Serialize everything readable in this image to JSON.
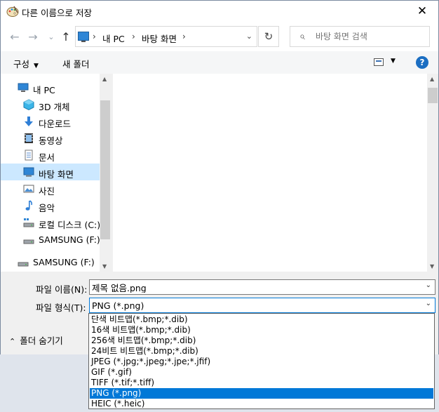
{
  "window": {
    "title": "다른 이름으로 저장",
    "close_glyph": "✕"
  },
  "nav": {
    "back_glyph": "←",
    "forward_glyph": "→",
    "recent_glyph": "⌄",
    "up_glyph": "↑",
    "breadcrumb": [
      "내 PC",
      "바탕 화면"
    ],
    "breadcrumb_sep": "›",
    "address_dropdown_glyph": "⌄",
    "refresh_glyph": "↻",
    "search_placeholder": "바탕 화면 검색"
  },
  "toolbar": {
    "organize_label": "구성",
    "organize_arrow": "▼",
    "new_folder_label": "새 폴더",
    "view_arrow": "▼",
    "help_label": "?"
  },
  "sidebar": {
    "items": [
      {
        "label": "내 PC",
        "icon": "pc-icon"
      },
      {
        "label": "3D 개체",
        "icon": "3d-objects-icon"
      },
      {
        "label": "다운로드",
        "icon": "download-icon"
      },
      {
        "label": "동영상",
        "icon": "video-icon"
      },
      {
        "label": "문서",
        "icon": "document-icon"
      },
      {
        "label": "바탕 화면",
        "icon": "desktop-icon",
        "selected": true
      },
      {
        "label": "사진",
        "icon": "pictures-icon"
      },
      {
        "label": "음악",
        "icon": "music-icon"
      },
      {
        "label": "로컬 디스크 (C:)",
        "icon": "drive-icon"
      },
      {
        "label": "SAMSUNG (F:)",
        "icon": "usb-drive-icon"
      },
      {
        "label": "SAMSUNG (F:)",
        "icon": "usb-drive-icon"
      }
    ],
    "scroll_up_glyph": "▲",
    "scroll_down_glyph": "▼"
  },
  "content": {
    "scroll_up_glyph": "▲",
    "scroll_down_glyph": "▼"
  },
  "form": {
    "filename_label": "파일 이름(N):",
    "filename_value": "제목 없음.png",
    "filetype_label": "파일 형식(T):",
    "filetype_value": "PNG (*.png)",
    "combo_arrow": "⌄",
    "hide_folders_arrow": "⌃",
    "hide_folders_label": "폴더 숨기기"
  },
  "dropdown": {
    "options": [
      "단색 비트맵(*.bmp;*.dib)",
      "16색 비트맵(*.bmp;*.dib)",
      "256색 비트맵(*.bmp;*.dib)",
      "24비트 비트맵(*.bmp;*.dib)",
      "JPEG (*.jpg;*.jpeg;*.jpe;*.jfif)",
      "GIF (*.gif)",
      "TIFF (*.tif;*.tiff)",
      "PNG (*.png)",
      "HEIC (*.heic)"
    ],
    "selected_index": 7
  },
  "colors": {
    "accent": "#0078d7",
    "selection_light": "#cce8ff",
    "help_blue": "#1b6ec2"
  }
}
